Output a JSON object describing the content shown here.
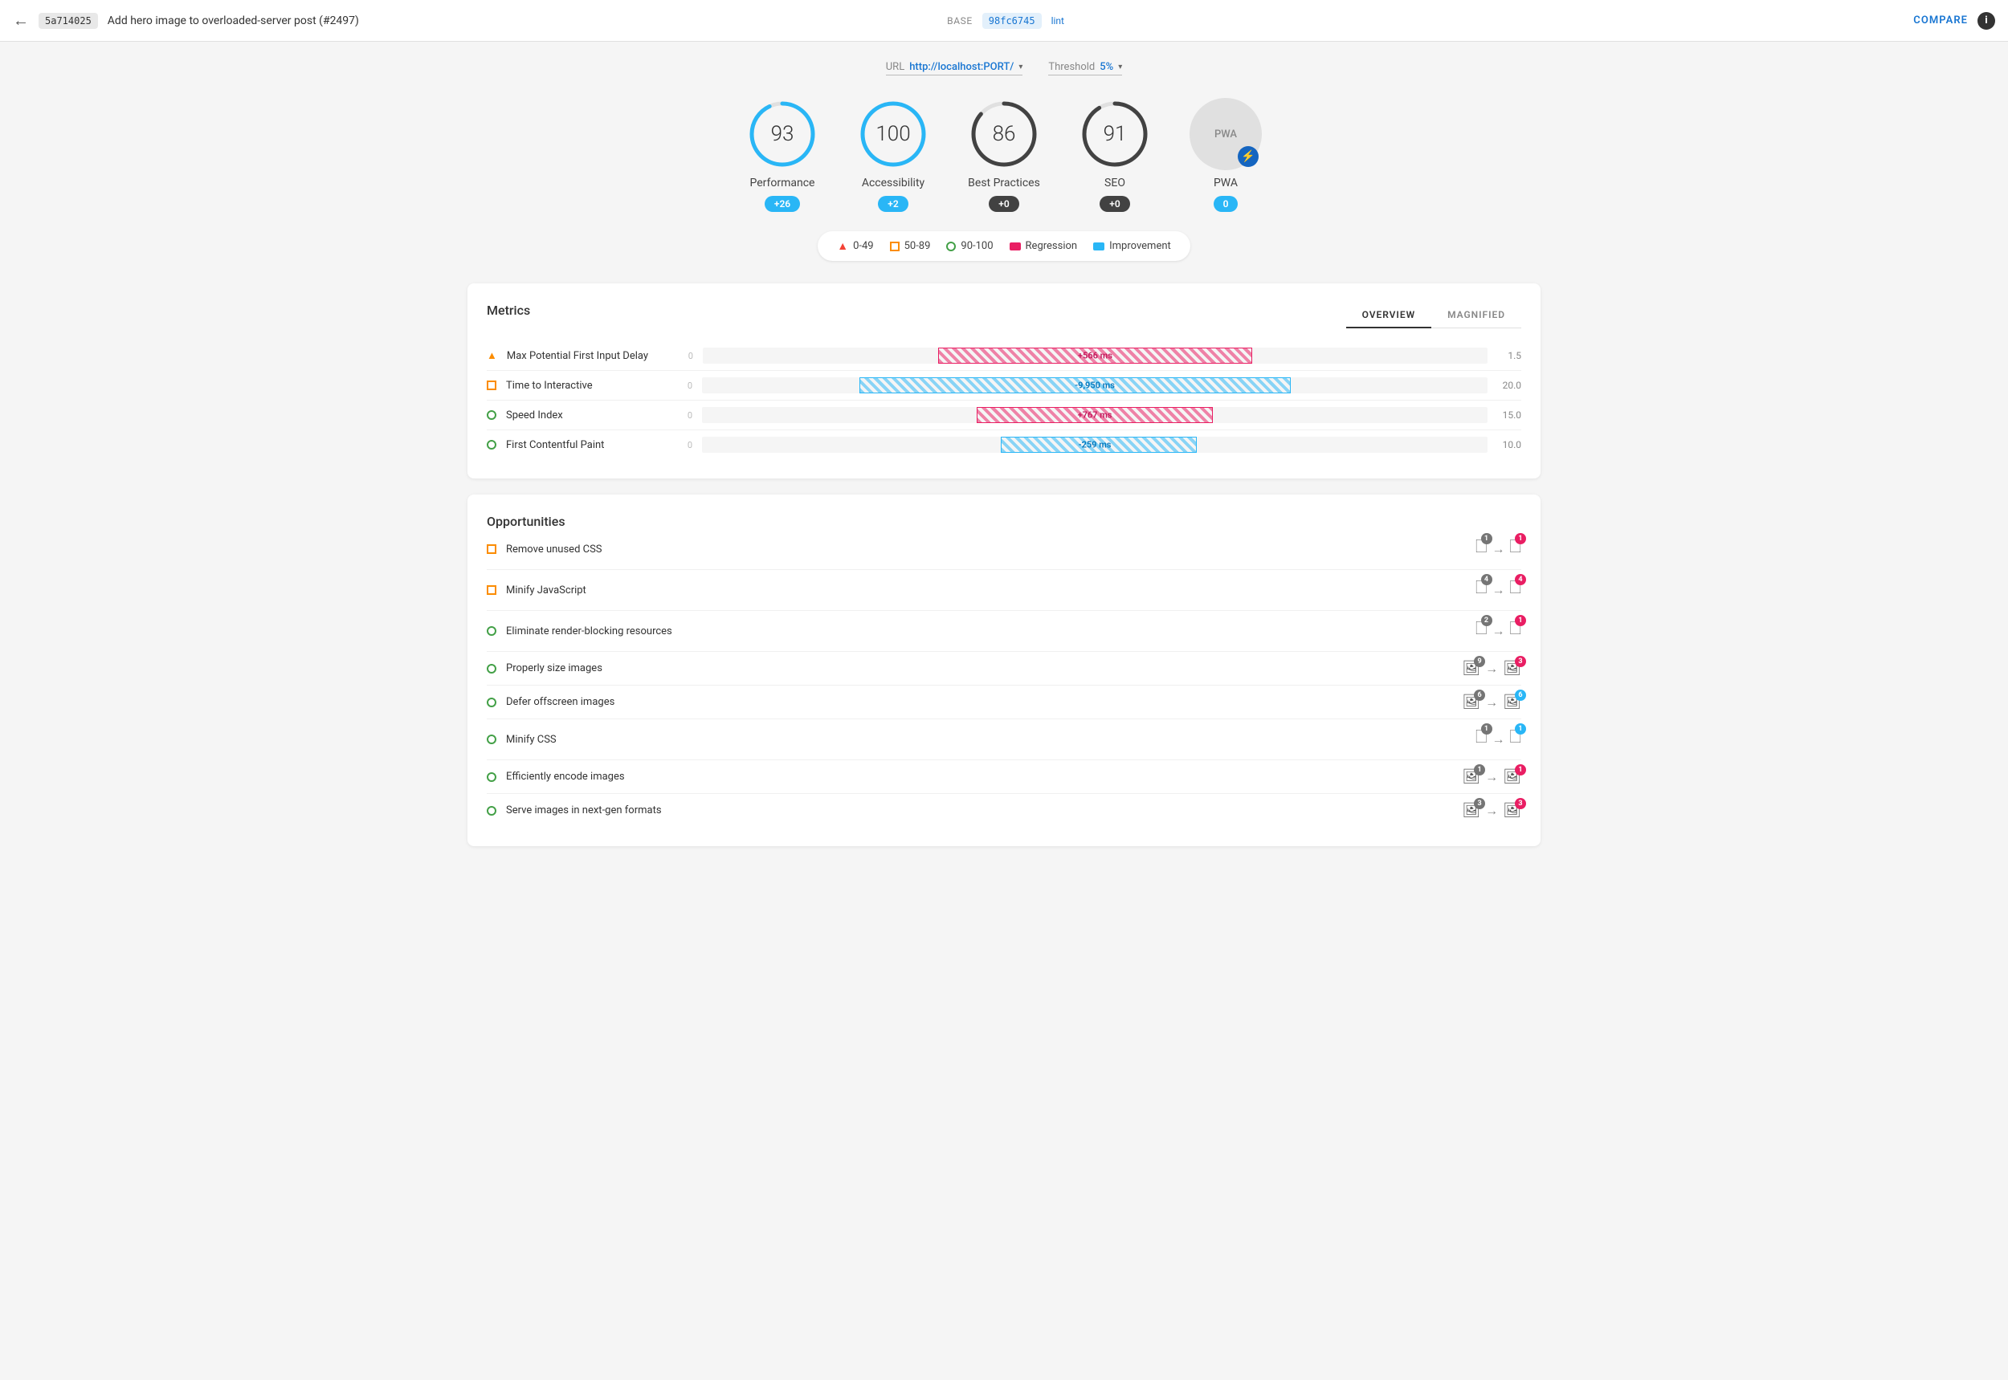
{
  "header": {
    "back_label": "←",
    "commit_hash_base": "5a714025",
    "commit_title": "Add hero image to overloaded-server post (#2497)",
    "base_label": "BASE",
    "commit_hash_lint": "98fc6745",
    "lint_label": "lint",
    "compare_label": "COMPARE",
    "info_label": "i"
  },
  "url_bar": {
    "url_label": "URL",
    "url_value": "http://localhost:PORT/",
    "threshold_label": "Threshold",
    "threshold_value": "5%"
  },
  "scores": [
    {
      "id": "performance",
      "value": "93",
      "label": "Performance",
      "badge": "+26",
      "badge_type": "blue",
      "color": "#29b6f6",
      "track_color": "#e0e0e0",
      "percent": 0.93
    },
    {
      "id": "accessibility",
      "value": "100",
      "label": "Accessibility",
      "badge": "+2",
      "badge_type": "blue",
      "color": "#29b6f6",
      "track_color": "#e0e0e0",
      "percent": 1.0
    },
    {
      "id": "best-practices",
      "value": "86",
      "label": "Best Practices",
      "badge": "+0",
      "badge_type": "dark",
      "color": "#424242",
      "track_color": "#e0e0e0",
      "percent": 0.86
    },
    {
      "id": "seo",
      "value": "91",
      "label": "SEO",
      "badge": "+0",
      "badge_type": "dark",
      "color": "#424242",
      "track_color": "#e0e0e0",
      "percent": 0.91
    }
  ],
  "pwa": {
    "label": "PWA",
    "badge": "0",
    "badge_type": "blue"
  },
  "legend": {
    "items": [
      {
        "id": "range-0-49",
        "icon": "triangle",
        "label": "0-49"
      },
      {
        "id": "range-50-89",
        "icon": "square-orange",
        "label": "50-89"
      },
      {
        "id": "range-90-100",
        "icon": "circle-green",
        "label": "90-100"
      },
      {
        "id": "regression",
        "icon": "rect-red",
        "label": "Regression"
      },
      {
        "id": "improvement",
        "icon": "rect-blue",
        "label": "Improvement"
      }
    ]
  },
  "metrics": {
    "title": "Metrics",
    "tabs": [
      {
        "id": "overview",
        "label": "OVERVIEW",
        "active": true
      },
      {
        "id": "magnified",
        "label": "MAGNIFIED",
        "active": false
      }
    ],
    "rows": [
      {
        "id": "max-potential-fid",
        "indicator": "triangle-orange",
        "name": "Max Potential First Input Delay",
        "zero": "0",
        "bar_type": "red-hatched",
        "bar_width": "40%",
        "bar_label": "+566 ms",
        "bar_label_type": "red",
        "score": "1.5"
      },
      {
        "id": "time-to-interactive",
        "indicator": "square-orange",
        "name": "Time to Interactive",
        "zero": "0",
        "bar_type": "blue-hatched",
        "bar_width": "55%",
        "bar_label": "-9,950 ms",
        "bar_label_type": "blue",
        "score": "20.0"
      },
      {
        "id": "speed-index",
        "indicator": "circle-green",
        "name": "Speed Index",
        "zero": "0",
        "bar_type": "red-hatched",
        "bar_width": "30%",
        "bar_label": "+767 ms",
        "bar_label_type": "red",
        "score": "15.0"
      },
      {
        "id": "first-contentful-paint",
        "indicator": "circle-green",
        "name": "First Contentful Paint",
        "zero": "0",
        "bar_type": "blue-hatched",
        "bar_width": "25%",
        "bar_label": "-259 ms",
        "bar_label_type": "blue",
        "score": "10.0"
      }
    ]
  },
  "opportunities": {
    "title": "Opportunities",
    "rows": [
      {
        "id": "remove-unused-css",
        "indicator": "square-orange",
        "name": "Remove unused CSS",
        "from_count": "1",
        "from_type": "css",
        "to_count": "1",
        "to_type": "css-red"
      },
      {
        "id": "minify-javascript",
        "indicator": "square-orange",
        "name": "Minify JavaScript",
        "from_count": "4",
        "from_type": "js",
        "to_count": "4",
        "to_type": "js-red"
      },
      {
        "id": "eliminate-render-blocking",
        "indicator": "circle-green",
        "name": "Eliminate render-blocking resources",
        "from_count": "2",
        "from_type": "css",
        "to_count": "1",
        "to_type": "css-red"
      },
      {
        "id": "properly-size-images",
        "indicator": "circle-green",
        "name": "Properly size images",
        "from_count": "9",
        "from_type": "img",
        "to_count": "3",
        "to_type": "img-red"
      },
      {
        "id": "defer-offscreen-images",
        "indicator": "circle-green",
        "name": "Defer offscreen images",
        "from_count": "6",
        "from_type": "img",
        "to_count": "6",
        "to_type": "img-blue"
      },
      {
        "id": "minify-css",
        "indicator": "circle-green",
        "name": "Minify CSS",
        "from_count": "1",
        "from_type": "css",
        "to_count": "1",
        "to_type": "css-blue"
      },
      {
        "id": "efficiently-encode-images",
        "indicator": "circle-green",
        "name": "Efficiently encode images",
        "from_count": "1",
        "from_type": "img",
        "to_count": "1",
        "to_type": "img-red"
      },
      {
        "id": "serve-next-gen-formats",
        "indicator": "circle-green",
        "name": "Serve images in next-gen formats",
        "from_count": "3",
        "from_type": "img",
        "to_count": "3",
        "to_type": "img-red"
      }
    ]
  }
}
